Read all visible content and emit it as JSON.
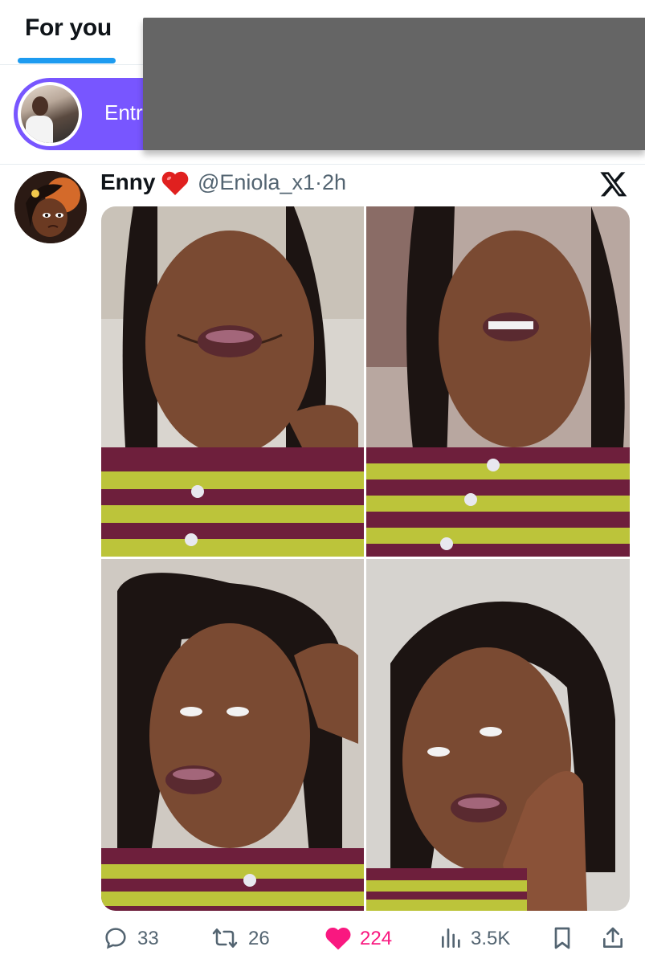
{
  "tabs": [
    {
      "label": "For you",
      "active": true
    }
  ],
  "space_banner": {
    "text": "Entr",
    "color": "#7856ff"
  },
  "post": {
    "author": {
      "name": "Enny",
      "name_emoji": "red-heart-emoji",
      "handle": "@Eniola_x1",
      "separator": "·",
      "time": "2h"
    },
    "source_icon": "x-logo-icon",
    "media": {
      "photo_count": 4
    },
    "actions": {
      "replies": "33",
      "reposts": "26",
      "likes": "224",
      "liked": true,
      "views": "3.5K"
    }
  },
  "colors": {
    "accent": "#1d9bf0",
    "like": "#f91880",
    "muted": "#536471"
  }
}
